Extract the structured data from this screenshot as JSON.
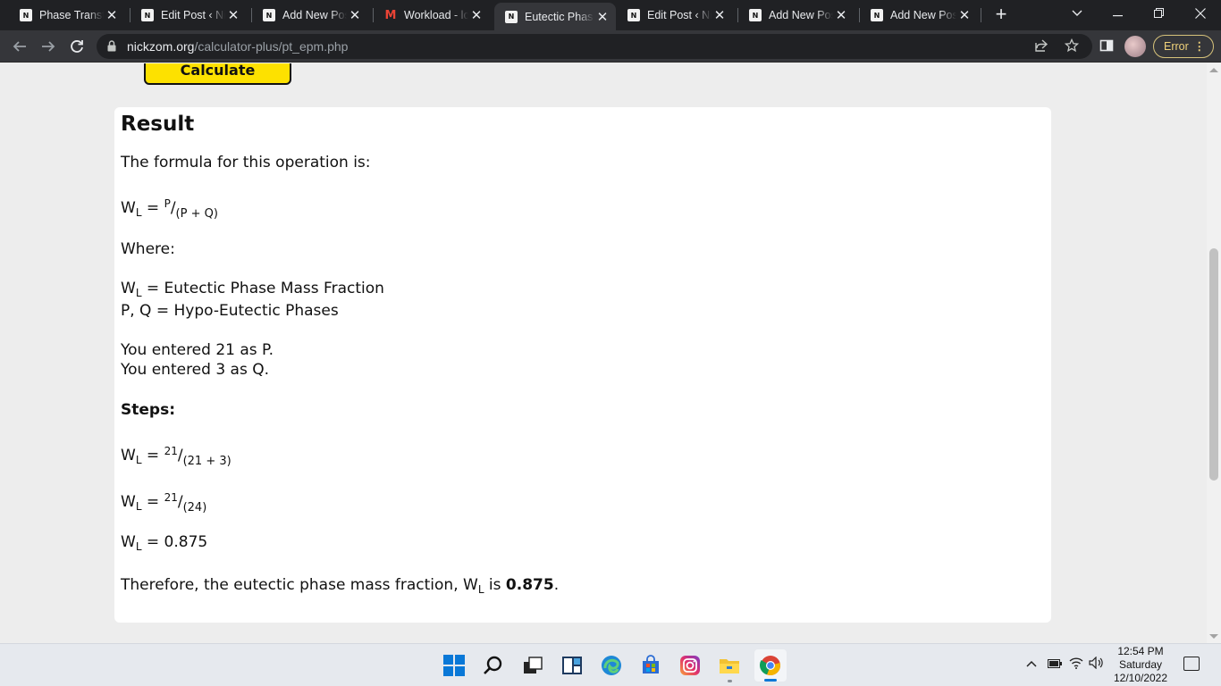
{
  "browser": {
    "tabs": [
      {
        "title": "Phase Transfo",
        "favicon": "nick-logo",
        "active": false
      },
      {
        "title": "Edit Post ‹ Nic",
        "favicon": "nick-logo",
        "active": false
      },
      {
        "title": "Add New Pos",
        "favicon": "nick-logo",
        "active": false
      },
      {
        "title": "Workload - lo",
        "favicon": "gmail-logo",
        "active": false
      },
      {
        "title": "Eutectic Phas",
        "favicon": "nick-logo",
        "active": true
      },
      {
        "title": "Edit Post ‹ Nic",
        "favicon": "nick-logo",
        "active": false
      },
      {
        "title": "Add New Pos",
        "favicon": "nick-logo",
        "active": false
      },
      {
        "title": "Add New Pos",
        "favicon": "nick-logo",
        "active": false
      }
    ],
    "url_host": "nickzom.org",
    "url_path": "/calculator-plus/pt_epm.php",
    "profile_status": "Error"
  },
  "page": {
    "calculate_label": "Calculate",
    "result_heading": "Result",
    "formula_intro": "The formula for this operation is:",
    "symbol_w": "W",
    "symbol_l": "L",
    "formula_numerator": "P",
    "formula_denominator": "(P + Q)",
    "where_label": "Where:",
    "def_wl_text": " = Eutectic Phase Mass Fraction",
    "def_pq_text": "P, Q = Hypo-Eutectic Phases",
    "entered_p": "You entered 21 as P.",
    "entered_q": "You entered 3 as Q.",
    "steps_label": "Steps:",
    "step1_numerator": "21",
    "step1_denominator": "(21 + 3)",
    "step2_numerator": "21",
    "step2_denominator": "(24)",
    "step3_value": " = 0.875",
    "conclusion_prefix": "Therefore, the eutectic phase mass fraction, W",
    "conclusion_mid": " is ",
    "conclusion_value": "0.875",
    "conclusion_suffix": "."
  },
  "taskbar": {
    "time": "12:54 PM",
    "day": "Saturday",
    "date": "12/10/2022"
  },
  "colors": {
    "accent_yellow": "#fde100",
    "chrome_dark": "#202124",
    "chrome_toolbar": "#35363a",
    "error_pill": "#f0d27a"
  }
}
